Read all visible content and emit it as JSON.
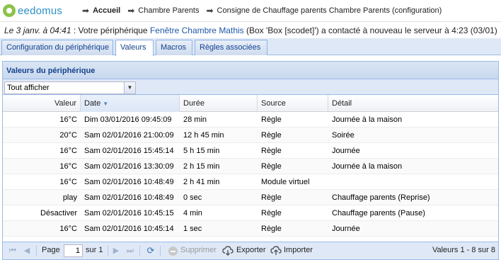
{
  "header": {
    "logo_text": "eedomus",
    "breadcrumb": [
      "Accueil",
      "Chambre Parents",
      "Consigne de Chauffage parents Chambre Parents (configuration)"
    ]
  },
  "status": {
    "timestamp": "Le 3 janv. à 04:41",
    "text_before": " : Votre périphérique ",
    "device": "Fenêtre Chambre Mathis",
    "text_after": " (Box 'Box [scodet]') a contacté à nouveau le serveur à 4:23 (03/01)"
  },
  "tabs": [
    {
      "label": "Configuration du périphérique",
      "active": false
    },
    {
      "label": "Valeurs",
      "active": true
    },
    {
      "label": "Macros",
      "active": false
    },
    {
      "label": "Règles associées",
      "active": false
    }
  ],
  "panel": {
    "title": "Valeurs du périphérique",
    "filter_value": "Tout afficher"
  },
  "grid": {
    "columns": [
      "Valeur",
      "Date",
      "Durée",
      "Source",
      "Détail"
    ],
    "rows": [
      [
        "16°C",
        "Dim 03/01/2016 09:45:09",
        "28 min",
        "Règle",
        "Journée à la maison"
      ],
      [
        "20°C",
        "Sam 02/01/2016 21:00:09",
        "12 h 45 min",
        "Règle",
        "Soirée"
      ],
      [
        "16°C",
        "Sam 02/01/2016 15:45:14",
        "5 h 15 min",
        "Règle",
        "Journée"
      ],
      [
        "16°C",
        "Sam 02/01/2016 13:30:09",
        "2 h 15 min",
        "Règle",
        "Journée à la maison"
      ],
      [
        "16°C",
        "Sam 02/01/2016 10:48:49",
        "2 h 41 min",
        "Module virtuel",
        ""
      ],
      [
        "play",
        "Sam 02/01/2016 10:48:49",
        "0 sec",
        "Règle",
        "Chauffage parents (Reprise)"
      ],
      [
        "Désactiver",
        "Sam 02/01/2016 10:45:15",
        "4 min",
        "Règle",
        "Chauffage parents (Pause)"
      ],
      [
        "16°C",
        "Sam 02/01/2016 10:45:14",
        "1 sec",
        "Règle",
        "Journée"
      ]
    ]
  },
  "pager": {
    "page_label": "Page",
    "page_value": "1",
    "of_label": "sur 1",
    "delete_label": "Supprimer",
    "export_label": "Exporter",
    "import_label": "Importer",
    "summary": "Valeurs 1 - 8 sur 8"
  }
}
